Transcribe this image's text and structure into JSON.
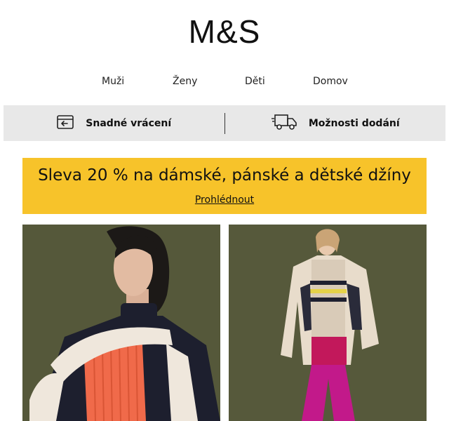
{
  "brand": {
    "logo_text": "M&S"
  },
  "nav": {
    "items": [
      {
        "label": "Muži"
      },
      {
        "label": "Ženy"
      },
      {
        "label": "Děti"
      },
      {
        "label": "Domov"
      }
    ]
  },
  "services": {
    "returns": {
      "label": "Snadné vrácení",
      "icon": "return-card-icon"
    },
    "delivery": {
      "label": "Možnosti dodání",
      "icon": "delivery-truck-icon"
    }
  },
  "promo": {
    "title": "Sleva 20 % na dámské, pánské a dětské džíny",
    "link_label": "Prohlédnout",
    "background": "#f7c32a"
  },
  "products": [
    {
      "image": "woman-in-colour-block-knit-photo"
    },
    {
      "image": "woman-in-striped-jumper-pink-trousers-photo"
    }
  ],
  "colors": {
    "service_bar": "#e8e8e8",
    "photo_backdrop": "#56593b"
  }
}
